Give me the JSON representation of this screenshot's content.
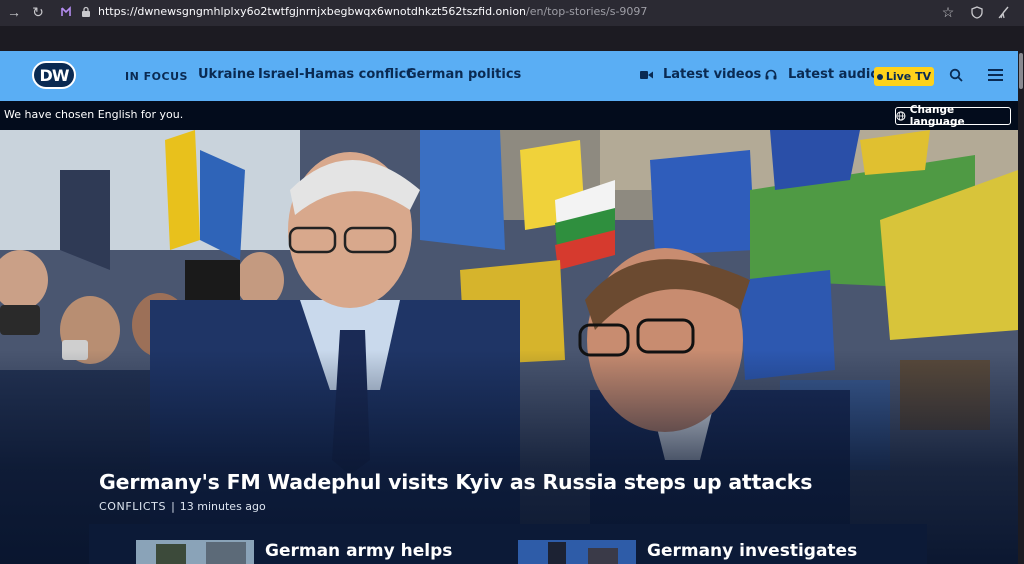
{
  "browser": {
    "url_main": "https://dwnewsgngmhlplxy6o2twtfgjnrnjxbegbwqx6wnotdhkzt562tszfid.onion",
    "url_path": "/en/top-stories/s-9097",
    "icons": [
      "back-icon",
      "reload-icon",
      "extension-icon",
      "lock-icon",
      "bookmark-star-icon",
      "shield-icon",
      "broom-icon"
    ]
  },
  "nav": {
    "logo": "DW",
    "in_focus": "IN FOCUS",
    "links": [
      "Ukraine",
      "Israel-Hamas conflict",
      "German politics"
    ],
    "latest_videos": "Latest videos",
    "latest_audio": "Latest audio",
    "live_tv": "Live TV",
    "colors": {
      "bar": "#5aaef4",
      "brand_dark": "#0a2a52",
      "live": "#ffd21a"
    }
  },
  "language": {
    "message": "We have chosen English for you.",
    "button": "Change language"
  },
  "hero": {
    "headline": "Germany's FM Wadephul visits Kyiv as Russia steps up attacks",
    "category": "CONFLICTS",
    "separator": "|",
    "time": "13 minutes ago"
  },
  "cards": [
    {
      "title": "German army helps"
    },
    {
      "title": "Germany investigates"
    }
  ]
}
